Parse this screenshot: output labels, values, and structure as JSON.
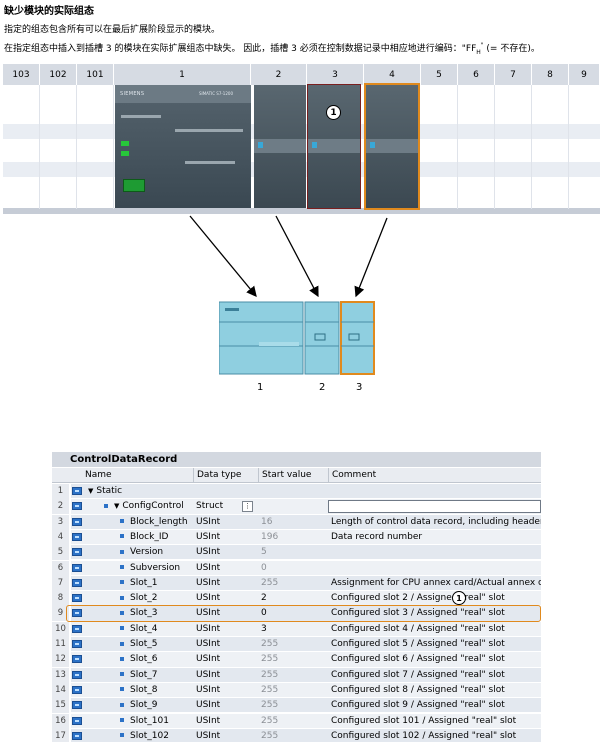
{
  "heading": "缺少模块的实际组态",
  "intro_line1": "指定的组态包含所有可以在最后扩展阶段显示的模块。",
  "intro_line2": "在指定组态中插入到插槽 3 的模块在实际扩展组态中缺失。 因此，插槽 3 必须在控制数据记录中相应地进行编码：\"FF",
  "intro_sub": "H",
  "intro_sup": "\"",
  "intro_end": "(= 不存在)。",
  "rack": {
    "slots": [
      "103",
      "102",
      "101",
      "1",
      "2",
      "3",
      "4",
      "5",
      "6",
      "7",
      "8",
      "9"
    ],
    "cpu_brand": "SIEMENS",
    "cpu_model": "SIMATIC S7-1200",
    "callout": "1"
  },
  "mini": {
    "labels": [
      "1",
      "2",
      "3"
    ]
  },
  "table": {
    "title": "ControlDataRecord",
    "headers": {
      "name": "Name",
      "type": "Data type",
      "start": "Start value",
      "comment": "Comment"
    },
    "callout": "1",
    "rows": [
      {
        "num": "1",
        "name": "Static",
        "type": "",
        "start": "",
        "comment": "",
        "level": 0,
        "expand": true,
        "dim": false
      },
      {
        "num": "2",
        "name": "ConfigControl",
        "type": "Struct",
        "start": "",
        "comment": "",
        "level": 1,
        "expand": true,
        "dim": false
      },
      {
        "num": "3",
        "name": "Block_length",
        "type": "USInt",
        "start": "16",
        "comment": "Length of control data record, including header",
        "level": 2,
        "dim": true
      },
      {
        "num": "4",
        "name": "Block_ID",
        "type": "USInt",
        "start": "196",
        "comment": "Data record number",
        "level": 2,
        "dim": true
      },
      {
        "num": "5",
        "name": "Version",
        "type": "USInt",
        "start": "5",
        "comment": "",
        "level": 2,
        "dim": true
      },
      {
        "num": "6",
        "name": "Subversion",
        "type": "USInt",
        "start": "0",
        "comment": "",
        "level": 2,
        "dim": true
      },
      {
        "num": "7",
        "name": "Slot_1",
        "type": "USInt",
        "start": "255",
        "comment": "Assignment for CPU annex card/Actual annex ca...",
        "level": 2,
        "dim": true
      },
      {
        "num": "8",
        "name": "Slot_2",
        "type": "USInt",
        "start": "2",
        "comment": "Configured slot 2 / Assigned \"real\" slot",
        "level": 2,
        "dim": false
      },
      {
        "num": "9",
        "name": "Slot_3",
        "type": "USInt",
        "start": "0",
        "comment": "Configured slot 3 / Assigned \"real\" slot",
        "level": 2,
        "dim": false
      },
      {
        "num": "10",
        "name": "Slot_4",
        "type": "USInt",
        "start": "3",
        "comment": "Configured slot 4 / Assigned \"real\" slot",
        "level": 2,
        "dim": false
      },
      {
        "num": "11",
        "name": "Slot_5",
        "type": "USInt",
        "start": "255",
        "comment": "Configured slot 5 / Assigned \"real\" slot",
        "level": 2,
        "dim": true
      },
      {
        "num": "12",
        "name": "Slot_6",
        "type": "USInt",
        "start": "255",
        "comment": "Configured slot 6 / Assigned \"real\" slot",
        "level": 2,
        "dim": true
      },
      {
        "num": "13",
        "name": "Slot_7",
        "type": "USInt",
        "start": "255",
        "comment": "Configured slot 7 / Assigned \"real\" slot",
        "level": 2,
        "dim": true
      },
      {
        "num": "14",
        "name": "Slot_8",
        "type": "USInt",
        "start": "255",
        "comment": "Configured slot 8 / Assigned \"real\" slot",
        "level": 2,
        "dim": true
      },
      {
        "num": "15",
        "name": "Slot_9",
        "type": "USInt",
        "start": "255",
        "comment": "Configured slot 9 / Assigned \"real\" slot",
        "level": 2,
        "dim": true
      },
      {
        "num": "16",
        "name": "Slot_101",
        "type": "USInt",
        "start": "255",
        "comment": "Configured slot 101 / Assigned \"real\" slot",
        "level": 2,
        "dim": true
      },
      {
        "num": "17",
        "name": "Slot_102",
        "type": "USInt",
        "start": "255",
        "comment": "Configured slot 102 / Assigned \"real\" slot",
        "level": 2,
        "dim": true
      }
    ]
  },
  "colors": {
    "highlight": "#e08a1e",
    "missing_outline": "#7a1f1f",
    "module_dark": "#3b4851",
    "mini_module": "#7fc4d6"
  }
}
